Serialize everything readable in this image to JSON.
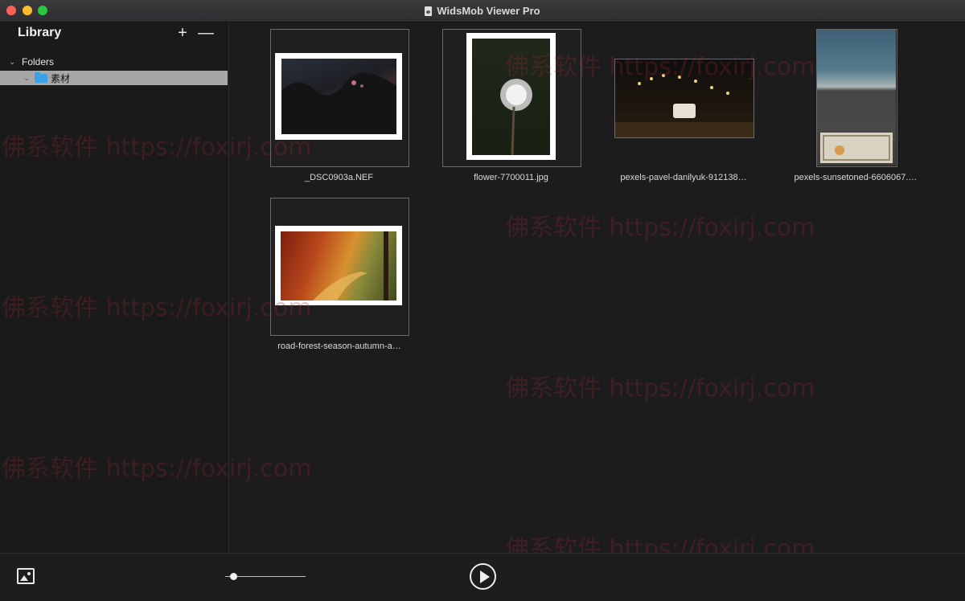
{
  "window": {
    "title": "WidsMob Viewer Pro"
  },
  "sidebar": {
    "title": "Library",
    "add_label": "+",
    "remove_label": "—",
    "folders_label": "Folders",
    "folder_name": "素材"
  },
  "thumbnails": [
    {
      "caption": "_DSC0903a.NEF"
    },
    {
      "caption": "flower-7700011.jpg"
    },
    {
      "caption": "pexels-pavel-danilyuk-912138…"
    },
    {
      "caption": "pexels-sunsetoned-6606067.…"
    },
    {
      "caption": "road-forest-season-autumn-a…"
    }
  ],
  "watermark": {
    "text": "佛系软件 https://foxirj.com"
  },
  "toolbar": {
    "zoom_level": 0.1
  }
}
